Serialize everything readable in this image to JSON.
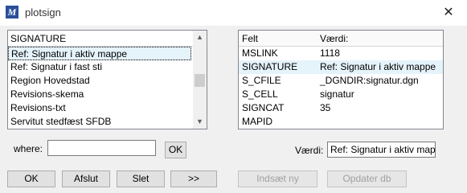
{
  "window": {
    "title": "plotsign",
    "icon": "microstation-icon",
    "close_glyph": "✕"
  },
  "left_list": {
    "header": "SIGNATURE",
    "items": [
      "Ref: Signatur i aktiv mappe",
      "Ref: Signatur i fast sti",
      "Region Hovedstad",
      "Revisions-skema",
      "Revisions-txt",
      "Servitut stedfæst SFDB"
    ],
    "selected_index": 0,
    "scroll_position": 0.52
  },
  "right_table": {
    "col_felt": "Felt",
    "col_vaerdi": "Værdi:",
    "rows": [
      {
        "felt": "MSLINK",
        "vaerdi": "1118"
      },
      {
        "felt": "SIGNATURE",
        "vaerdi": "Ref: Signatur i aktiv mappe"
      },
      {
        "felt": "S_CFILE",
        "vaerdi": "_DGNDIR:signatur.dgn"
      },
      {
        "felt": "S_CELL",
        "vaerdi": "signatur"
      },
      {
        "felt": "SIGNCAT",
        "vaerdi": "35"
      },
      {
        "felt": "MAPID",
        "vaerdi": ""
      }
    ],
    "selected_index": 1
  },
  "where": {
    "label": "where:",
    "value": "",
    "ok_label": "OK"
  },
  "vaerdi_field": {
    "label": "Værdi:",
    "value": "Ref: Signatur i aktiv mappe"
  },
  "buttons": {
    "ok": "OK",
    "afslut": "Afslut",
    "slet": "Slet",
    "next": ">>",
    "indsaet": "Indsæt ny",
    "opdater": "Opdater db"
  },
  "colors": {
    "selection": "#e5f3fb",
    "border": "#828790",
    "dialog_bg": "#f0f0f0"
  }
}
